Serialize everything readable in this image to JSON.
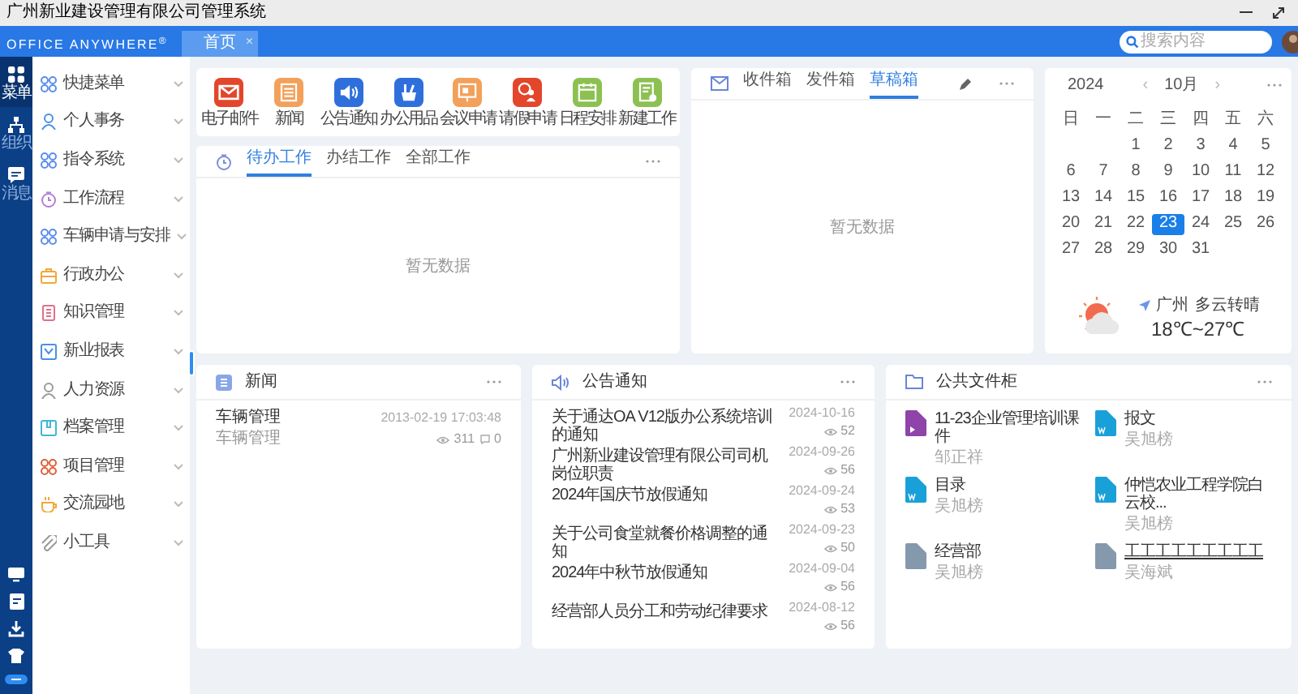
{
  "window": {
    "title": "广州新业建设管理有限公司管理系统"
  },
  "header": {
    "logo": "OFFICE ANYWHERE$^{®}$",
    "tabs": [
      {
        "label": "首页",
        "selected": true,
        "close": "×"
      }
    ],
    "search": {
      "placeholder": "搜索内容"
    }
  },
  "rail": {
    "items": [
      {
        "label": "菜单",
        "kind": "grid",
        "selected": true
      },
      {
        "label": "组织",
        "kind": "org",
        "selected": false
      },
      {
        "label": "消息",
        "kind": "chat",
        "selected": false
      }
    ]
  },
  "sidebar": {
    "items": [
      {
        "label": "快捷菜单",
        "kind": "grid",
        "color": "#5b8def"
      },
      {
        "label": "个人事务",
        "kind": "person",
        "color": "#4a90e2"
      },
      {
        "label": "指令系统",
        "kind": "grid",
        "color": "#5b8def"
      },
      {
        "label": "工作流程",
        "kind": "clock",
        "color": "#b27fd6"
      },
      {
        "label": "车辆申请与安排",
        "kind": "grid",
        "color": "#5b8def"
      },
      {
        "label": "行政办公",
        "kind": "briefcase",
        "color": "#f0a83a"
      },
      {
        "label": "知识管理",
        "kind": "book",
        "color": "#e0708a"
      },
      {
        "label": "新业报表",
        "kind": "chart",
        "color": "#4a90e2"
      },
      {
        "label": "人力资源",
        "kind": "person",
        "color": "#999999"
      },
      {
        "label": "档案管理",
        "kind": "archive",
        "color": "#3fb8d6"
      },
      {
        "label": "项目管理",
        "kind": "grid",
        "color": "#e0603a"
      },
      {
        "label": "交流园地",
        "kind": "cup",
        "color": "#f0a83a"
      },
      {
        "label": "小工具",
        "kind": "clip",
        "color": "#999999"
      }
    ]
  },
  "apps": [
    {
      "label": "电子邮件",
      "kind": "mail",
      "color": "#e3462b"
    },
    {
      "label": "新闻",
      "kind": "news",
      "color": "#f3a05a"
    },
    {
      "label": "公告通知",
      "kind": "speaker",
      "color": "#2f6fdc"
    },
    {
      "label": "办公用品",
      "kind": "supplies",
      "color": "#2f6fdc"
    },
    {
      "label": "会议申请",
      "kind": "board",
      "color": "#f3a05a"
    },
    {
      "label": "请假申请",
      "kind": "leave",
      "color": "#e3462b"
    },
    {
      "label": "日程安排",
      "kind": "calendar",
      "color": "#8cc152"
    },
    {
      "label": "新建工作",
      "kind": "newwork",
      "color": "#8cc152"
    }
  ],
  "work": {
    "tabs": [
      {
        "label": "待办工作",
        "selected": true
      },
      {
        "label": "办结工作",
        "selected": false
      },
      {
        "label": "全部工作",
        "selected": false
      }
    ],
    "empty": "暂无数据"
  },
  "mail": {
    "tabs": [
      {
        "label": "收件箱",
        "selected": false
      },
      {
        "label": "发件箱",
        "selected": false
      },
      {
        "label": "草稿箱",
        "selected": true
      }
    ],
    "empty": "暂无数据"
  },
  "calendar": {
    "year": "2024",
    "month": "10月",
    "prev": "‹",
    "next": "›",
    "weekdays": [
      "日",
      "一",
      "二",
      "三",
      "四",
      "五",
      "六"
    ],
    "weeks": [
      [
        {
          "label": "1",
          "selected": false
        },
        {
          "label": "2",
          "selected": false
        },
        {
          "label": "3",
          "selected": false
        },
        {
          "label": "4",
          "selected": false
        },
        {
          "label": "5",
          "selected": false
        }
      ],
      [
        {
          "label": "6",
          "selected": false
        },
        {
          "label": "7",
          "selected": false
        },
        {
          "label": "8",
          "selected": false
        },
        {
          "label": "9",
          "selected": false
        },
        {
          "label": "10",
          "selected": false
        },
        {
          "label": "11",
          "selected": false
        },
        {
          "label": "12",
          "selected": false
        }
      ],
      [
        {
          "label": "13",
          "selected": false
        },
        {
          "label": "14",
          "selected": false
        },
        {
          "label": "15",
          "selected": false
        },
        {
          "label": "16",
          "selected": false
        },
        {
          "label": "17",
          "selected": false
        },
        {
          "label": "18",
          "selected": false
        },
        {
          "label": "19",
          "selected": false
        }
      ],
      [
        {
          "label": "20",
          "selected": false
        },
        {
          "label": "21",
          "selected": false
        },
        {
          "label": "22",
          "selected": false
        },
        {
          "label": "23",
          "selected": true
        },
        {
          "label": "24",
          "selected": false
        },
        {
          "label": "25",
          "selected": false
        },
        {
          "label": "26",
          "selected": false
        }
      ],
      [
        {
          "label": "27",
          "selected": false
        },
        {
          "label": "28",
          "selected": false
        },
        {
          "label": "29",
          "selected": false
        },
        {
          "label": "30",
          "selected": false
        },
        {
          "label": "31",
          "selected": false
        }
      ]
    ],
    "weather": {
      "city": "广州",
      "condition": "多云转晴",
      "temperature": "18℃~27℃"
    }
  },
  "news": {
    "title": "新闻",
    "items": [
      {
        "title": "车辆管理",
        "subtitle": "车辆管理",
        "time": "2013-02-19 17:03:48",
        "views": "311",
        "comments": "0"
      }
    ]
  },
  "notices": {
    "title": "公告通知",
    "items": [
      {
        "title": "关于通达OA V12版办公系统培训的通知",
        "date": "2024-10-16",
        "views": "52"
      },
      {
        "title": "广州新业建设管理有限公司司机岗位职责",
        "date": "2024-09-26",
        "views": "56"
      },
      {
        "title": "2024年国庆节放假通知",
        "date": "2024-09-24",
        "views": "53"
      },
      {
        "title": "关于公司食堂就餐价格调整的通知",
        "date": "2024-09-23",
        "views": "50"
      },
      {
        "title": "2024年中秋节放假通知",
        "date": "2024-09-04",
        "views": "56"
      },
      {
        "title": "经营部人员分工和劳动纪律要求",
        "date": "2024-08-12",
        "views": "56"
      }
    ]
  },
  "files": {
    "title": "公共文件柜",
    "items": [
      {
        "name": "11-23企业管理培训课件",
        "owner": "邹正祥",
        "kind": "video"
      },
      {
        "name": "报文",
        "owner": "吴旭榜",
        "kind": "word"
      },
      {
        "name": "目录",
        "owner": "吴旭榜",
        "kind": "word"
      },
      {
        "name": "仲恺农业工程学院白云校...",
        "owner": "吴旭榜",
        "kind": "word"
      },
      {
        "name": "经营部",
        "owner": "吴旭榜",
        "kind": "folder"
      },
      {
        "name": "工工工工工工工工工",
        "owner": "吴海斌",
        "kind": "folder"
      }
    ]
  }
}
